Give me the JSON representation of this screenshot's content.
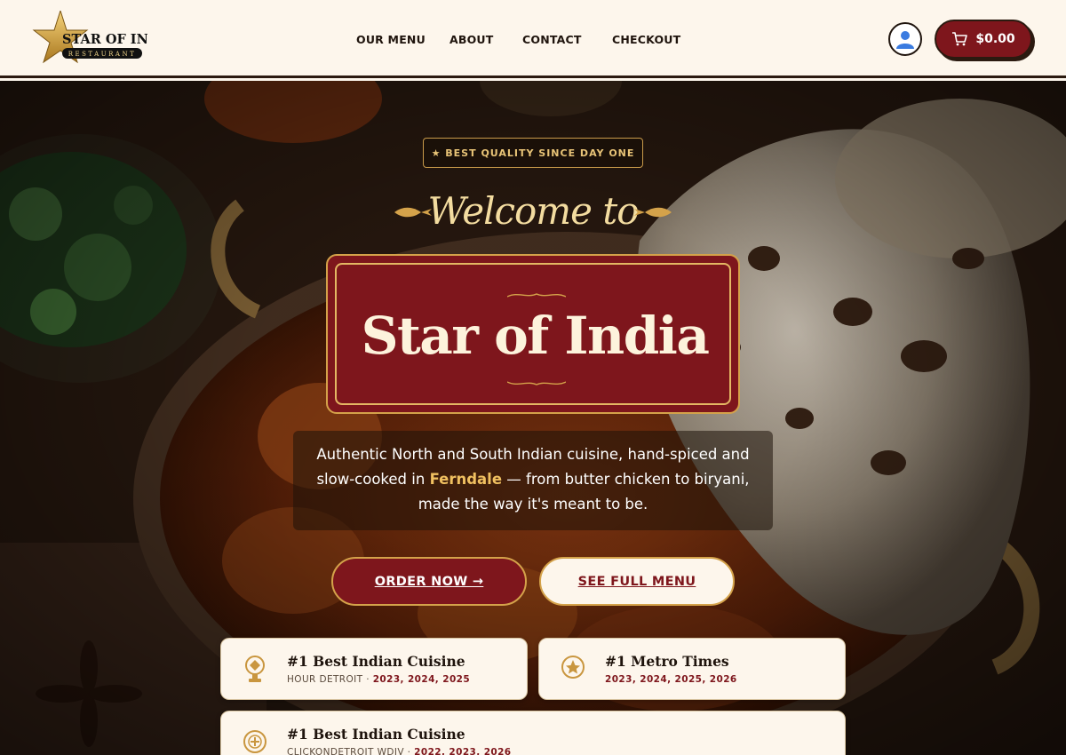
{
  "header": {
    "logo": {
      "name": "STAR OF INDIA",
      "tag": "RESTAURANT"
    },
    "nav": [
      "OUR MENU",
      "ABOUT",
      "CONTACT",
      "CHECKOUT"
    ],
    "cart_total": "$0.00"
  },
  "hero": {
    "badge": "★ BEST QUALITY SINCE DAY ONE",
    "welcome": "Welcome to",
    "title": "Star of India",
    "tagline": {
      "line1": "Authentic North and South Indian cuisine, hand-spiced and",
      "line2_before": "slow-cooked in ",
      "line2_highlight": "Ferndale",
      "line2_after": " — from butter chicken to biryani,",
      "line3": "made the way it's meant to be."
    },
    "order_button": "ORDER NOW →",
    "menu_button": "SEE FULL MENU"
  },
  "awards": [
    {
      "title": "#1 Best Indian Cuisine",
      "source": "HOUR DETROIT · ",
      "years": "2023, 2024, 2025"
    },
    {
      "title": "#1 Metro Times",
      "source": "",
      "years": "2023, 2024, 2025, 2026"
    },
    {
      "title": "#1 Best Indian Cuisine",
      "source": "CLICKONDETROIT WDIV · ",
      "years": "2022, 2023, 2026"
    }
  ],
  "icons": {
    "account": "user-icon",
    "cart": "cart-icon",
    "awards": [
      "trophy-icon",
      "star-medal-icon",
      "plus-medal-icon"
    ]
  },
  "colors": {
    "brand_red": "#7e161c",
    "gold": "#d4a24a",
    "cream": "#fdf6ec",
    "text_dark": "#1f140d"
  }
}
